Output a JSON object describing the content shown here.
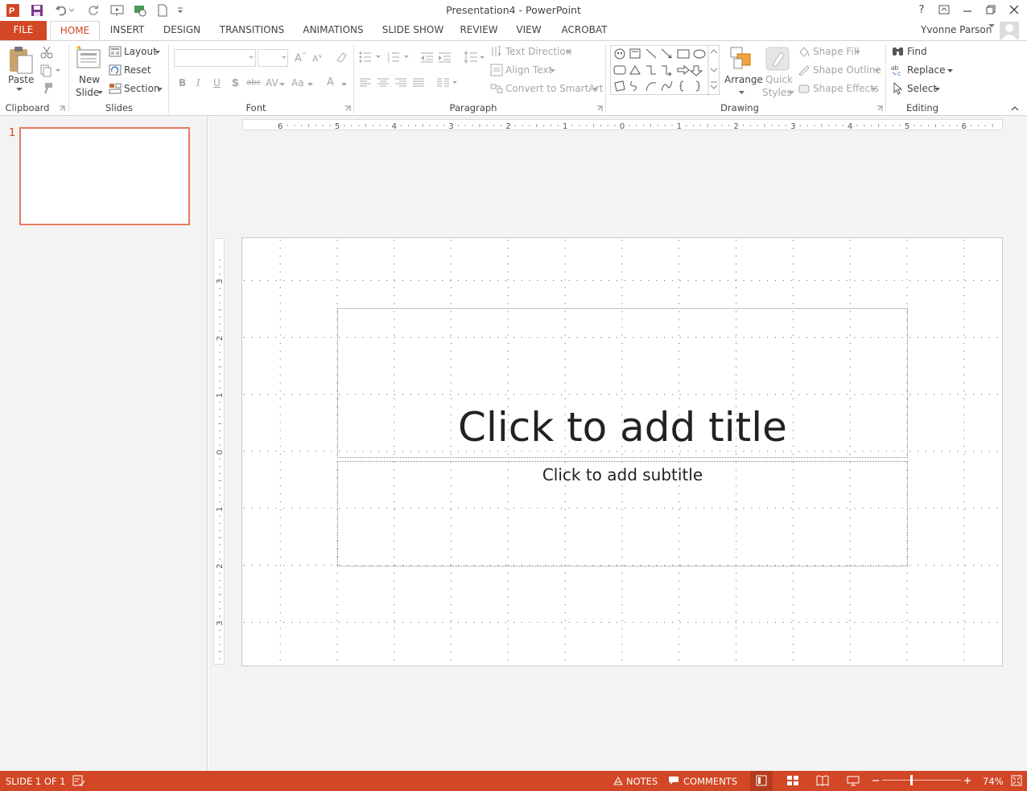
{
  "window": {
    "title": "Presentation4 - PowerPoint",
    "help": "?",
    "user": "Yvonne Parson"
  },
  "tabs": [
    "FILE",
    "HOME",
    "INSERT",
    "DESIGN",
    "TRANSITIONS",
    "ANIMATIONS",
    "SLIDE SHOW",
    "REVIEW",
    "VIEW",
    "ACROBAT"
  ],
  "ribbon": {
    "clipboard": {
      "label": "Clipboard",
      "paste": "Paste"
    },
    "slides": {
      "label": "Slides",
      "new_slide_line1": "New",
      "new_slide_line2": "Slide",
      "layout": "Layout",
      "reset": "Reset",
      "section": "Section"
    },
    "font": {
      "label": "Font",
      "bold": "B",
      "italic": "I",
      "underline": "U",
      "shadow": "S",
      "strike": "abc",
      "spacing": "AV",
      "case": "Aa",
      "color": "A"
    },
    "paragraph": {
      "label": "Paragraph",
      "text_direction": "Text Direction",
      "align_text": "Align Text",
      "convert_smartart": "Convert to SmartArt"
    },
    "drawing": {
      "label": "Drawing",
      "arrange": "Arrange",
      "quick_styles_line1": "Quick",
      "quick_styles_line2": "Styles",
      "shape_fill": "Shape Fill",
      "shape_outline": "Shape Outline",
      "shape_effects": "Shape Effects"
    },
    "editing": {
      "label": "Editing",
      "find": "Find",
      "replace": "Replace",
      "select": "Select"
    }
  },
  "thumbnails": [
    {
      "number": "1"
    }
  ],
  "ruler": {
    "horizontal": [
      "6",
      "5",
      "4",
      "3",
      "2",
      "1",
      "0",
      "1",
      "2",
      "3",
      "4",
      "5",
      "6"
    ],
    "vertical": [
      "3",
      "2",
      "1",
      "0",
      "1",
      "2",
      "3"
    ]
  },
  "slide": {
    "title_placeholder": "Click to add title",
    "subtitle_placeholder": "Click to add subtitle"
  },
  "status": {
    "slide_indicator": "SLIDE 1 OF 1",
    "notes": "NOTES",
    "comments": "COMMENTS",
    "zoom": "74%",
    "zoom_level": 0.74
  },
  "colors": {
    "accent": "#d24726"
  }
}
